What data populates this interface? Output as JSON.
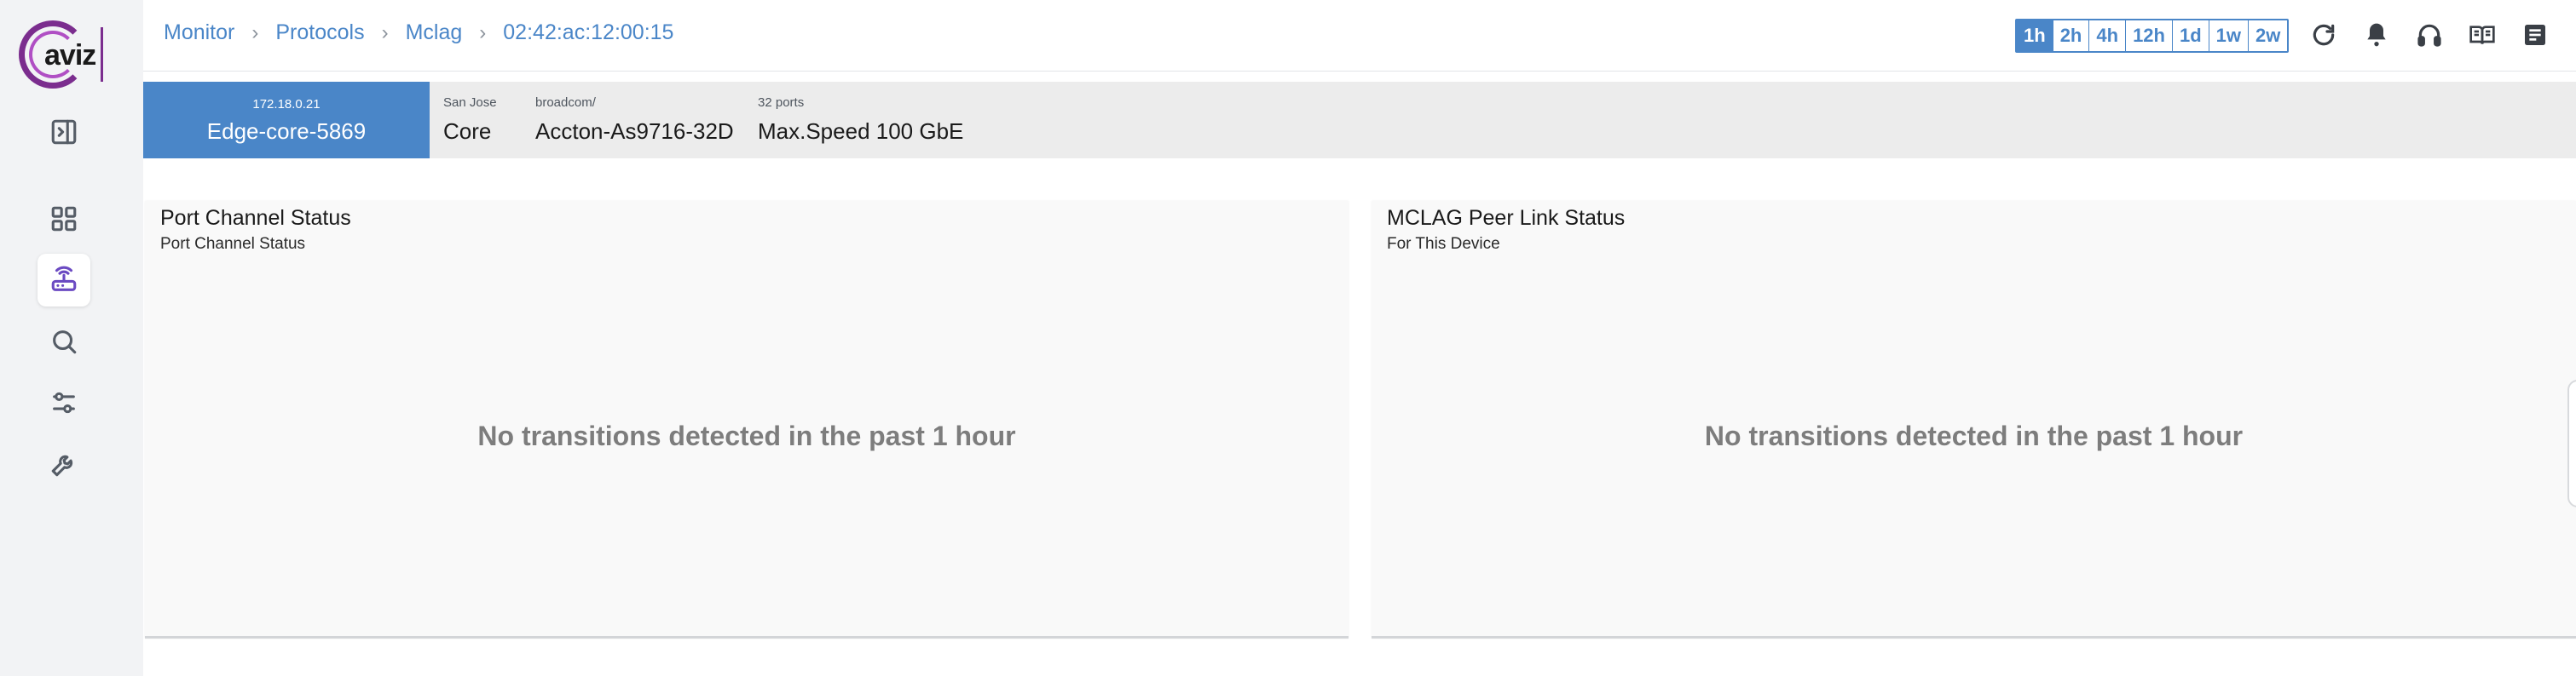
{
  "logo": {
    "text": "aviz"
  },
  "sidebar": {
    "items": [
      {
        "name": "collapse",
        "icon": "sidebar-collapse-icon"
      },
      {
        "name": "dashboard",
        "icon": "dashboard-grid-icon"
      },
      {
        "name": "devices",
        "icon": "router-icon",
        "active": true
      },
      {
        "name": "search",
        "icon": "search-icon"
      },
      {
        "name": "settings",
        "icon": "sliders-icon"
      },
      {
        "name": "tools",
        "icon": "wrench-icon"
      }
    ]
  },
  "breadcrumb": [
    "Monitor",
    "Protocols",
    "Mclag",
    "02:42:ac:12:00:15"
  ],
  "time_ranges": {
    "options": [
      "1h",
      "2h",
      "4h",
      "12h",
      "1d",
      "1w",
      "2w"
    ],
    "selected": "1h"
  },
  "header_icons": [
    "refresh-icon",
    "bell-icon",
    "headset-icon",
    "book-icon",
    "notes-icon"
  ],
  "device": {
    "ip": "172.18.0.21",
    "name": "Edge-core-5869",
    "location_label": "San Jose",
    "location_value": "Core",
    "vendor_label": "broadcom/",
    "model": "Accton-As9716-32D",
    "ports_label": "32 ports",
    "speed": "Max.Speed 100 GbE"
  },
  "panels": [
    {
      "title": "Port Channel Status",
      "subtitle": "Port Channel Status",
      "empty_message": "No transitions detected in the past 1 hour"
    },
    {
      "title": "MCLAG Peer Link Status",
      "subtitle": "For This Device",
      "empty_message": "No transitions detected in the past 1 hour"
    }
  ],
  "colors": {
    "accent": "#4a86c8",
    "brand": "#7b2d8e",
    "sidebar_bg": "#f2f3f5",
    "device_bar_bg": "#ececec"
  }
}
